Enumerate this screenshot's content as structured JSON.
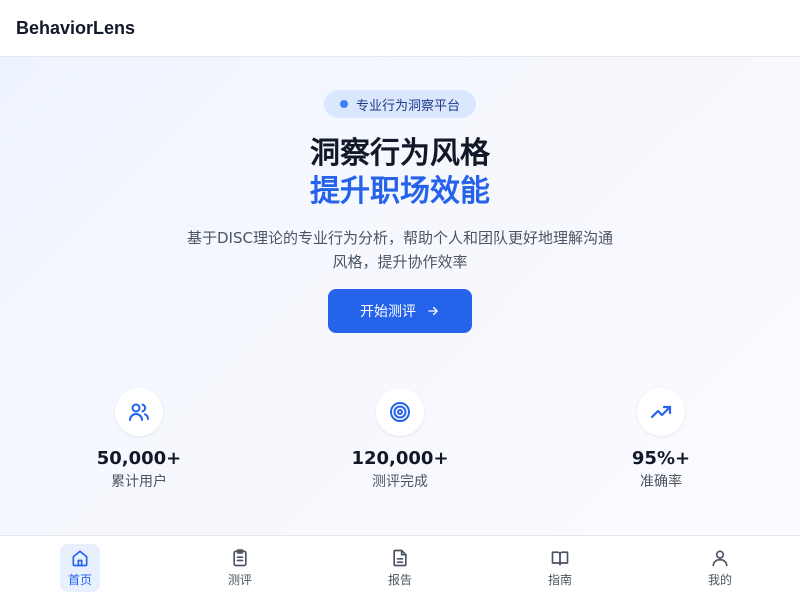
{
  "header": {
    "brand": "BehaviorLens"
  },
  "hero": {
    "badge": "专业行为洞察平台",
    "title_line1": "洞察行为风格",
    "title_line2": "提升职场效能",
    "description": "基于DISC理论的专业行为分析，帮助个人和团队更好地理解沟通风格，提升协作效率",
    "cta_label": "开始测评"
  },
  "stats": [
    {
      "icon": "users-icon",
      "value": "50,000+",
      "label": "累计用户"
    },
    {
      "icon": "target-icon",
      "value": "120,000+",
      "label": "测评完成"
    },
    {
      "icon": "trending-up-icon",
      "value": "95%+",
      "label": "准确率"
    }
  ],
  "tabbar": {
    "items": [
      {
        "icon": "home-icon",
        "label": "首页",
        "active": true
      },
      {
        "icon": "clipboard-icon",
        "label": "测评",
        "active": false
      },
      {
        "icon": "document-icon",
        "label": "报告",
        "active": false
      },
      {
        "icon": "book-icon",
        "label": "指南",
        "active": false
      },
      {
        "icon": "user-icon",
        "label": "我的",
        "active": false
      }
    ]
  },
  "colors": {
    "primary": "#2563eb",
    "badge_bg": "#dbe7fd",
    "text_dark": "#111827",
    "text_muted": "#4b5563"
  }
}
